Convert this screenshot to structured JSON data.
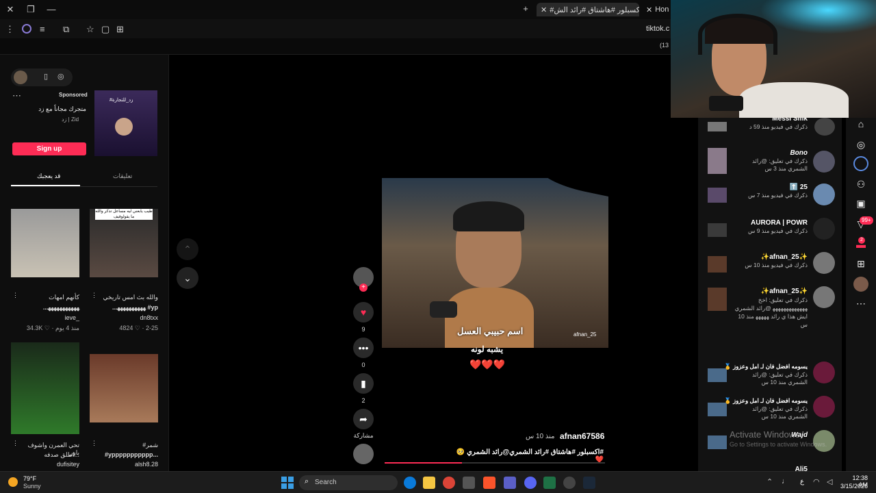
{
  "browser": {
    "tabs": [
      {
        "label": "#اكسبلور #هاشتاق #رائد الش"
      },
      {
        "label": "Hon"
      }
    ],
    "address": "tiktok.c",
    "bookmark_tail": "(13"
  },
  "left": {
    "ad": {
      "sponsored": "Sponsored",
      "title": "متجرك مجاناً مع زد",
      "brand": "زد | Zid",
      "thumb_text": "#زد_للتجارة",
      "cta": "Sign up"
    },
    "tabs": [
      "قد يعجبك",
      "تعليقات"
    ],
    "videos": [
      {
        "title": "كأنهم امهات",
        "author": "ieve_",
        "stats": "34.3K ♡ · منذ 4 يوم",
        "more": "⋮",
        "line2": "...ﮭﮭﮭﮭﮭﮭﮭﮭﮭﮭﮭ"
      },
      {
        "title": "والله بث امس تاريخي",
        "author": "dn8txx",
        "stats": "4824 ♡ · 2-25",
        "more": "⋮",
        "line2": "...ﮭﮭﮭﮭﮭﮭﮭﮭﮭﮭ #yp",
        "overlay": "طيب يابعني ليه مساعل تذكر والله ما يقولوقيف"
      },
      {
        "title": "تحي العمرن واشوف باور",
        "author": "dufisitey",
        "stats": "",
        "more": "⋮",
        "line2": "اطلق صدفه..."
      },
      {
        "title": "#شمر",
        "author": "alsh8.28",
        "stats": "",
        "more": "⋮",
        "line2": "#yppppppppppp..."
      }
    ]
  },
  "video": {
    "caption1": "اسم حبيبي العسل",
    "caption2": "يشبه لونه",
    "hearts": "❤️❤️❤️",
    "watermark": "afnan_25",
    "author": "afnan67586",
    "time": "منذ 10 س",
    "description": "#اكسبلور #هاشتاق #رائد الشمري@رائد الشمري 🥺 ❤️",
    "likes": "9",
    "comments": "0",
    "saves": "2",
    "share_label": "مشاركة"
  },
  "notifications": [
    {
      "name": "Messi Smk",
      "meta": "ذكرك في فيديو منذ 59 د"
    },
    {
      "name": "Bono",
      "meta": "ذكرك في تعليق: @رائد الشمري منذ 3 س"
    },
    {
      "name": "25 ⬆️",
      "meta": "ذكرك في فيديو منذ 7 س"
    },
    {
      "name": "AURORA | POWR",
      "meta": "ذكرك في فيديو منذ 9 س"
    },
    {
      "name": "✨afnan_25✨",
      "meta": "ذكرك في فيديو منذ 10 س"
    },
    {
      "name": "✨afnan_25✨",
      "meta": "ذكرك في تعليق: اخخ ﮭﮭﮭﮭﮭﮭﮭﮭﮭﮭﮭﮭﮭ @رائد الشمري ايش هذا ي رائد ﮭﮭﮭﮭﮭ منذ 10 س"
    },
    {
      "name": "يسومه افضل فان لـ امل وعزوز 🥇",
      "meta": "ذكرك في تعليق: @رائد الشمري منذ 10 س"
    },
    {
      "name": "يسومه افضل فان لـ امل وعزوز 🥇",
      "meta": "ذكرك في تعليق: @رائد الشمري منذ 10 س"
    },
    {
      "name": "Wajd",
      "meta": ""
    },
    {
      "name": "Ali5",
      "meta": ""
    }
  ],
  "nav_badges": {
    "inbox": "99+",
    "messages": "2"
  },
  "watermark": {
    "line1": "Activate Windows",
    "line2": "Go to Settings to activate Windows."
  },
  "taskbar": {
    "weather_temp": "79°F",
    "weather_desc": "Sunny",
    "search": "Search",
    "lang": "ع",
    "time": "12:38 AM",
    "date": "3/15/2026"
  },
  "colors": {
    "accent": "#fe2c55",
    "bg": "#000000"
  }
}
